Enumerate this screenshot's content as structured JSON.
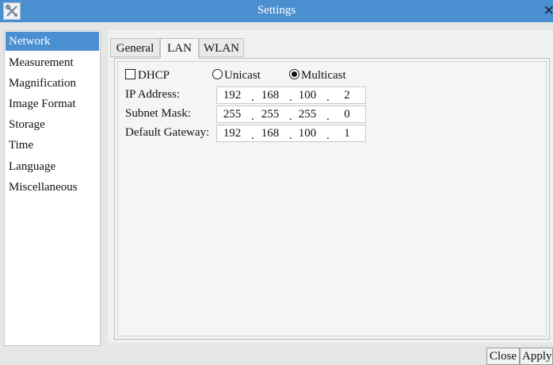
{
  "window": {
    "title": "Settings",
    "close_glyph": "×",
    "app_icon": "tools-icon"
  },
  "sidebar": {
    "items": [
      {
        "label": "Network",
        "selected": true
      },
      {
        "label": "Measurement"
      },
      {
        "label": "Magnification"
      },
      {
        "label": "Image Format"
      },
      {
        "label": "Storage"
      },
      {
        "label": "Time"
      },
      {
        "label": "Language"
      },
      {
        "label": "Miscellaneous"
      }
    ]
  },
  "tabs": [
    {
      "label": "General"
    },
    {
      "label": "LAN",
      "active": true
    },
    {
      "label": "WLAN"
    }
  ],
  "lan": {
    "dhcp_label": "DHCP",
    "dhcp_checked": false,
    "unicast_label": "Unicast",
    "multicast_label": "Multicast",
    "selected_mode": "Multicast",
    "ip_label": "IP Address:",
    "ip": [
      "192",
      "168",
      "100",
      "2"
    ],
    "subnet_label": "Subnet Mask:",
    "subnet": [
      "255",
      "255",
      "255",
      "0"
    ],
    "gateway_label": "Default Gateway:",
    "gateway": [
      "192",
      "168",
      "100",
      "1"
    ]
  },
  "buttons": {
    "close_label": "Close",
    "apply_label": "Apply"
  },
  "colors": {
    "accent": "#4a8fd0",
    "background": "#e6e6e6"
  }
}
